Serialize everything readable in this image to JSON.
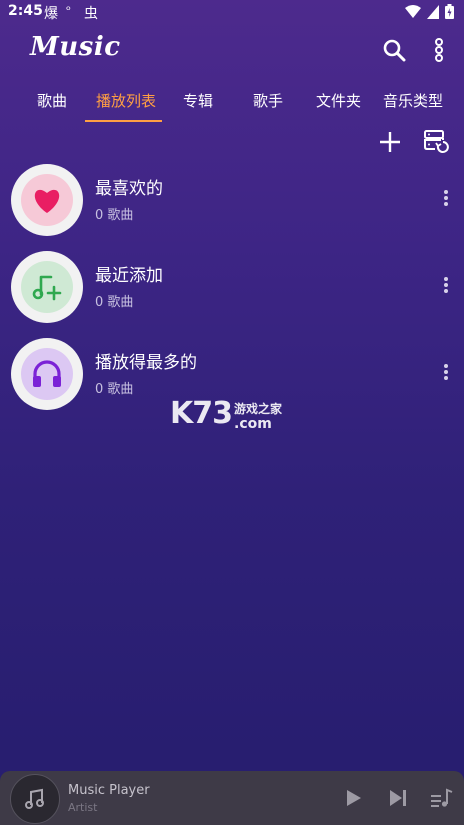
{
  "status_bar": {
    "time": "2:45",
    "app_icon_1": "爆",
    "app_icon_2": "ᵒ",
    "app_icon_3": "虫"
  },
  "app": {
    "logo": "Music"
  },
  "tabs": [
    {
      "label": "歌曲",
      "active": false
    },
    {
      "label": "播放列表",
      "active": true
    },
    {
      "label": "专辑",
      "active": false
    },
    {
      "label": "歌手",
      "active": false
    },
    {
      "label": "文件夹",
      "active": false
    },
    {
      "label": "音乐类型",
      "active": false
    }
  ],
  "playlists": [
    {
      "title": "最喜欢的",
      "subtitle": "0 歌曲",
      "icon": "heart-icon",
      "icon_color": "#e91e63",
      "icon_bg": "#f6c9d7"
    },
    {
      "title": "最近添加",
      "subtitle": "0 歌曲",
      "icon": "music-add-icon",
      "icon_color": "#2fa84f",
      "icon_bg": "#cfe9d4"
    },
    {
      "title": "播放得最多的",
      "subtitle": "0 歌曲",
      "icon": "headphones-icon",
      "icon_color": "#7b22d6",
      "icon_bg": "#dcc8f3"
    }
  ],
  "watermark": {
    "big": "K73",
    "cn": "游戏之家",
    "com": ".com"
  },
  "mini_player": {
    "title": "Music Player",
    "artist": "Artist"
  },
  "colors": {
    "accent": "#ff9f43",
    "background_top": "#4d2a8d",
    "background_bottom": "#261d6e",
    "player_bg": "#3e3a47"
  }
}
